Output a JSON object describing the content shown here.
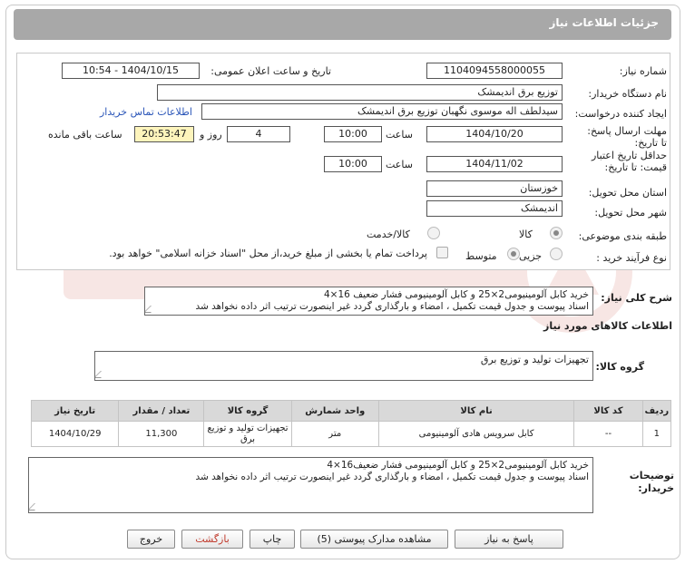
{
  "header": {
    "title": "جزئیات اطلاعات نیاز"
  },
  "form": {
    "need_number_label": "شماره نیاز:",
    "need_number": "1104094558000055",
    "announce_label": "تاریخ و ساعت اعلان عمومی:",
    "announce_value": "1404/10/15 - 10:54",
    "buyer_org_label": "نام دستگاه خریدار:",
    "buyer_org": "توزیع برق اندیمشک",
    "creator_label": "ایجاد کننده درخواست:",
    "creator": "سیدلطف اله موسوی نگهبان توزیع برق اندیمشک",
    "contact_link": "اطلاعات تماس خریدار",
    "deadline_label": "مهلت ارسال پاسخ: تا تاریخ:",
    "deadline_date": "1404/10/20",
    "time_word": "ساعت",
    "deadline_time": "10:00",
    "days_count": "4",
    "days_and": "روز و",
    "remaining_time": "20:53:47",
    "remaining_label": "ساعت باقی مانده",
    "validity_label": "حداقل تاریخ اعتبار قیمت: تا تاریخ:",
    "validity_date": "1404/11/02",
    "validity_time": "10:00",
    "province_label": "استان محل تحویل:",
    "province": "خوزستان",
    "city_label": "شهر محل تحویل:",
    "city": "اندیمشک",
    "category_label": "طبقه بندی موضوعی:",
    "category_options": [
      "کالا",
      "کالا/خدمت"
    ],
    "purchase_type_label": "نوع فرآیند خرید :",
    "purchase_options": [
      "جزیی",
      "متوسط"
    ],
    "payment_note": "پرداخت تمام یا بخشی از مبلغ خرید،از محل \"اسناد خزانه اسلامی\" خواهد بود."
  },
  "description": {
    "label": "شرح کلی نیاز:",
    "line1": "خرید کابل آلومینیومی2×25 و کابل آلومینیومی فشار ضعیف 16×4",
    "line2": "اسناد پیوست و جدول قیمت تکمیل ، امضاء  و بارگذاری گردد غیر اینصورت ترتیب اثر داده نخواهد شد"
  },
  "goods": {
    "section_title": "اطلاعات کالاهای مورد نیاز",
    "group_label": "گروه کالا:",
    "group_value": "تجهیزات تولید و توزیع برق"
  },
  "table": {
    "headers": [
      "ردیف",
      "کد کالا",
      "نام کالا",
      "واحد شمارش",
      "گروه کالا",
      "تعداد / مقدار",
      "تاریخ نیاز"
    ],
    "rows": [
      [
        "1",
        "--",
        "کابل سرویس هادی آلومینیومی",
        "متر",
        "تجهیزات تولید و توزیع برق",
        "11,300",
        "1404/10/29"
      ]
    ]
  },
  "buyer_notes": {
    "label": "توضیحات خریدار:",
    "line1": "خرید کابل آلومینیومی2×25 و کابل آلومینیومی فشار ضعیف16×4",
    "line2": "اسناد پیوست و جدول قیمت تکمیل ، امضاء  و بارگذاری گردد غیر اینصورت ترتیب اثر داده نخواهد شد"
  },
  "buttons": {
    "reply": "پاسخ به نیاز",
    "attachments": "مشاهده مدارک پیوستی (5)",
    "print": "چاپ",
    "back": "بازگشت",
    "exit": "خروج"
  },
  "colors": {
    "header_bg": "#a8a8a8",
    "highlight": "#fdf4bc",
    "link": "#2a55b8",
    "back_button_text": "#c0392b"
  }
}
